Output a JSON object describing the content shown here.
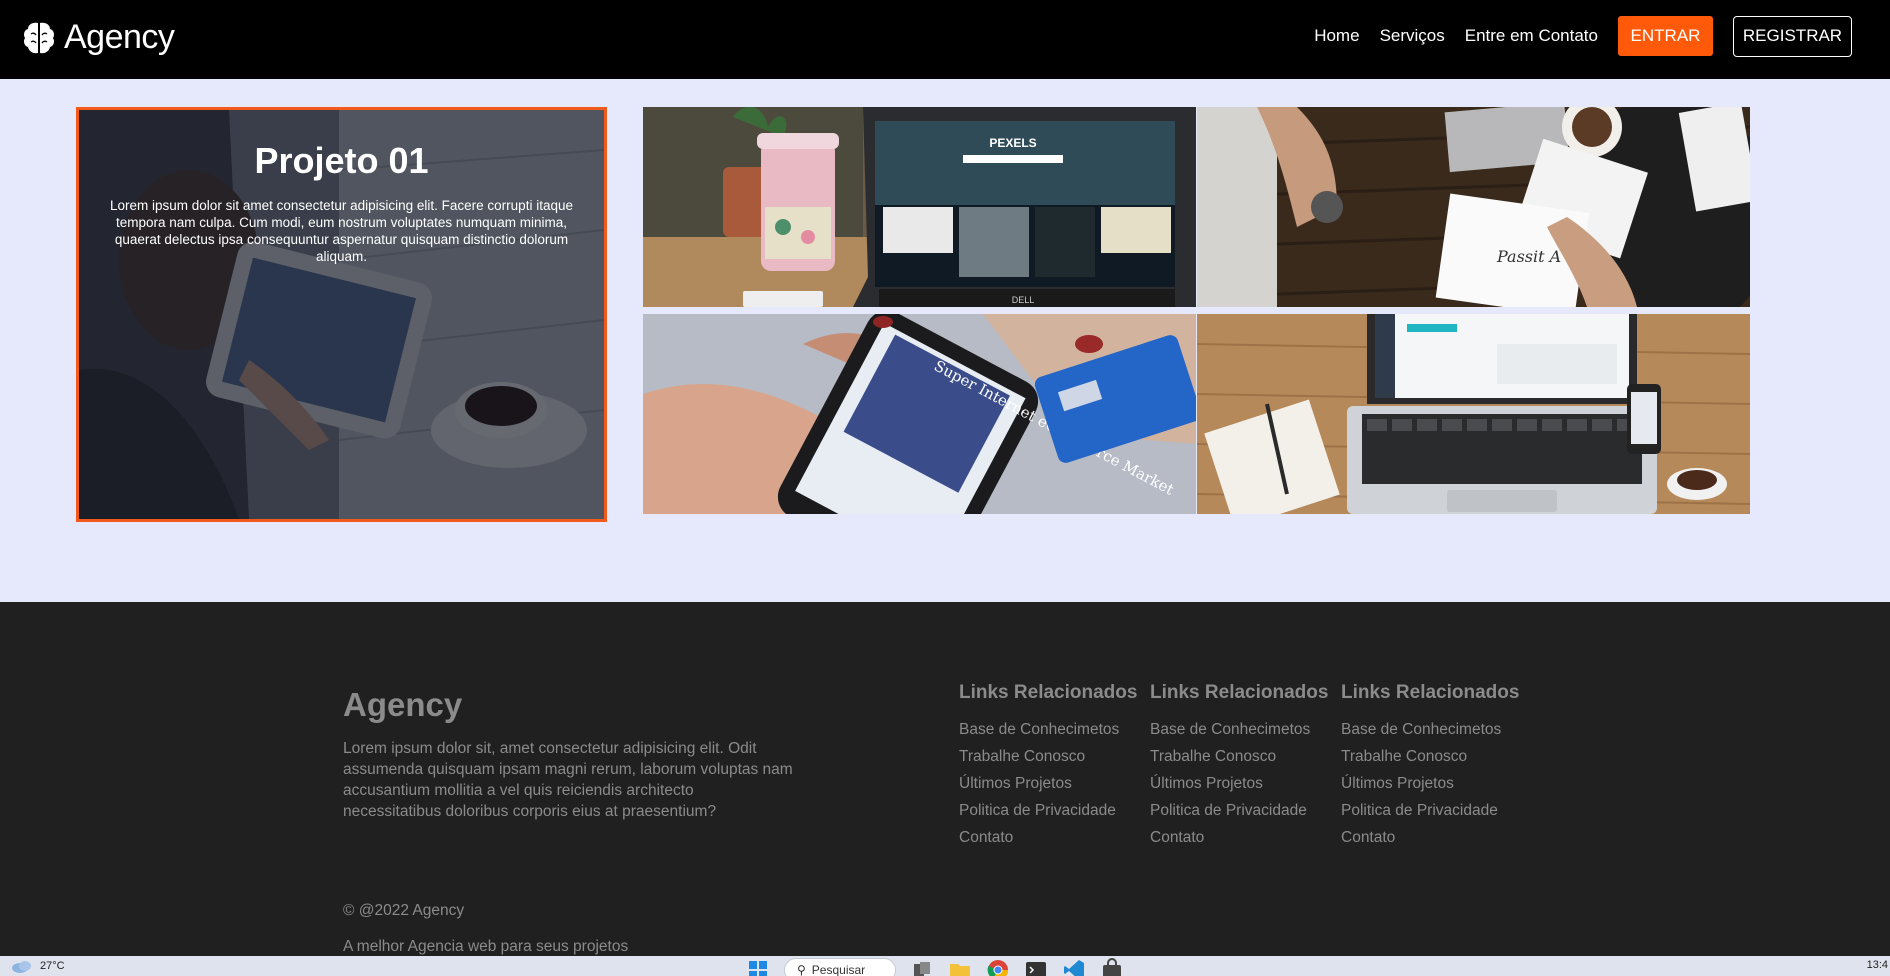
{
  "navbar": {
    "brand": "Agency",
    "logo_icon": "brain-icon",
    "links": [
      "Home",
      "Serviços",
      "Entre em Contato"
    ],
    "login_label": "ENTRAR",
    "register_label": "REGISTRAR"
  },
  "project": {
    "title": "Projeto 01",
    "description": "Lorem ipsum dolor sit amet consectetur adipisicing elit. Facere corrupti itaque tempora nam culpa. Cum modi, eum nostrum voluptates numquam minima, quaerat delectus ipsa consequuntur aspernatur quisquam distinctio dolorum aliquam."
  },
  "gallery": {
    "image1_text": "PEXELS",
    "image3_text": "Super Internet eCommerce Market"
  },
  "footer": {
    "brand": "Agency",
    "about": "Lorem ipsum dolor sit, amet consectetur adipisicing elit. Odit assumenda quisquam ipsam magni rerum, laborum voluptas nam accusantium mollitia a vel quis reiciendis architecto necessitatibus doloribus corporis eius at praesentium?",
    "columns": [
      {
        "title": "Links Relacionados",
        "links": [
          "Base de Conhecimetos",
          "Trabalhe Conosco",
          "Últimos Projetos",
          "Politica de Privacidade",
          "Contato"
        ]
      },
      {
        "title": "Links Relacionados",
        "links": [
          "Base de Conhecimetos",
          "Trabalhe Conosco",
          "Últimos Projetos",
          "Politica de Privacidade",
          "Contato"
        ]
      },
      {
        "title": "Links Relacionados",
        "links": [
          "Base de Conhecimetos",
          "Trabalhe Conosco",
          "Últimos Projetos",
          "Politica de Privacidade",
          "Contato"
        ]
      }
    ],
    "copyright": "© @2022 Agency",
    "tagline": "A melhor Agencia web para seus projetos"
  },
  "taskbar": {
    "temperature": "27°C",
    "search_placeholder": "Pesquisar",
    "clock": "13:4"
  },
  "colors": {
    "accent": "#ff5a0a",
    "page_bg": "#e6e9fb",
    "footer_bg": "#202020",
    "footer_text": "#8b8b8b"
  }
}
